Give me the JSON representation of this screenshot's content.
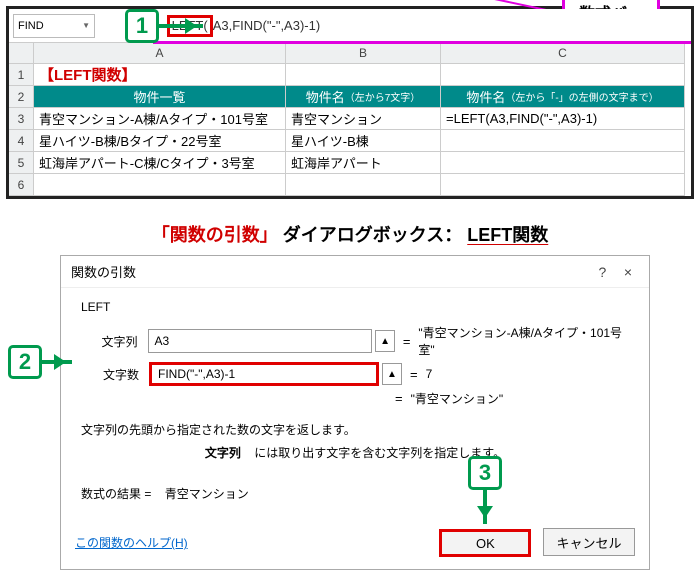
{
  "callouts": {
    "formula_bar_label": "数式バー"
  },
  "steps": {
    "s1": "1",
    "s2": "2",
    "s3": "3"
  },
  "excel": {
    "namebox": "FIND",
    "formula_prefix": "=",
    "formula_hl": "LEFT(",
    "formula_rest": "A3,FIND(\"-\",A3)-1)",
    "col_blank": "",
    "colA": "A",
    "colB": "B",
    "colC": "C",
    "rows": [
      "1",
      "2",
      "3",
      "4",
      "5",
      "6"
    ],
    "r1A": "【LEFT関数】",
    "h_A": "物件一覧",
    "h_B_main": "物件名",
    "h_B_sub": "（左から7文字）",
    "h_C_main": "物件名",
    "h_C_sub": "（左から「-」の左側の文字まで）",
    "r3A": "青空マンション-A棟/Aタイプ・101号室",
    "r3B": "青空マンション",
    "r3C": "=LEFT(A3,FIND(\"-\",A3)-1)",
    "r4A": "星ハイツ-B棟/Bタイプ・22号室",
    "r4B": "星ハイツ-B棟",
    "r5A": "虹海岸アパート-C棟/Cタイプ・3号室",
    "r5B": "虹海岸アパート"
  },
  "heading": {
    "part1": "「関数の引数」",
    "part2": "ダイアログボックス：",
    "part3": "LEFT関数"
  },
  "dialog": {
    "title": "関数の引数",
    "help": "?",
    "close": "×",
    "fname": "LEFT",
    "arg1_label": "文字列",
    "arg1_value": "A3",
    "arg1_preview": "\"青空マンション-A棟/Aタイプ・101号室\"",
    "arg2_label": "文字数",
    "arg2_value": "FIND(\"-\",A3)-1",
    "arg2_preview": "7",
    "result_preview": "\"青空マンション\"",
    "desc1": "文字列の先頭から指定された数の文字を返します。",
    "desc2_label": "文字列",
    "desc2_text": "には取り出す文字を含む文字列を指定します。",
    "result_label": "数式の結果 =",
    "result_value": "青空マンション",
    "help_link": "この関数のヘルプ(H)",
    "ok": "OK",
    "cancel": "キャンセル",
    "eq": "="
  }
}
